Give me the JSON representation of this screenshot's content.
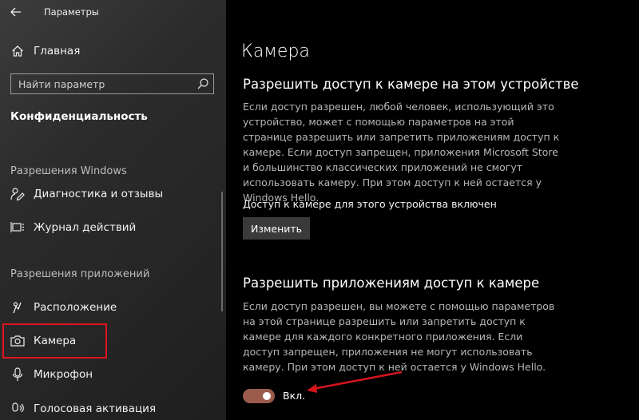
{
  "window": {
    "title": "Параметры"
  },
  "sidebar": {
    "home_label": "Главная",
    "search": {
      "placeholder": "Найти параметр"
    },
    "category": "Конфиденциальность",
    "groups": [
      {
        "heading": "Разрешения Windows",
        "items": [
          {
            "label": "Диагностика и отзывы",
            "icon": "feedback-icon"
          },
          {
            "label": "Журнал действий",
            "icon": "activity-history-icon"
          }
        ]
      },
      {
        "heading": "Разрешения приложений",
        "items": [
          {
            "label": "Расположение",
            "icon": "location-icon"
          },
          {
            "label": "Камера",
            "icon": "camera-icon",
            "selected": true
          },
          {
            "label": "Микрофон",
            "icon": "microphone-icon"
          },
          {
            "label": "Голосовая активация",
            "icon": "voice-activation-icon"
          }
        ]
      }
    ]
  },
  "main": {
    "title": "Камера",
    "device_section": {
      "heading": "Разрешить доступ к камере на этом устройстве",
      "description": "Если доступ разрешен, любой человек, использующий это устройство, может с помощью параметров на этой странице разрешить или запретить приложениям доступ к камере. Если доступ запрещен, приложения Microsoft Store и большинство классических приложений не смогут использовать камеру. При этом доступ к ней остается у Windows Hello.",
      "status": "Доступ к камере для этого устройства включен",
      "change_button": "Изменить"
    },
    "apps_section": {
      "heading": "Разрешить приложениям доступ к камере",
      "description": "Если доступ разрешен, вы можете с помощью параметров на этой странице разрешить или запретить доступ к камере для каждого конкретного приложения. Если доступ запрещен, приложения не могут использовать камеру. При этом доступ к ней остается у Windows Hello.",
      "toggle_label": "Вкл.",
      "toggle_on": true
    }
  },
  "colors": {
    "highlight": "#e0141e",
    "toggle_on": "#9a5b4b",
    "arrow": "#d4141c"
  }
}
